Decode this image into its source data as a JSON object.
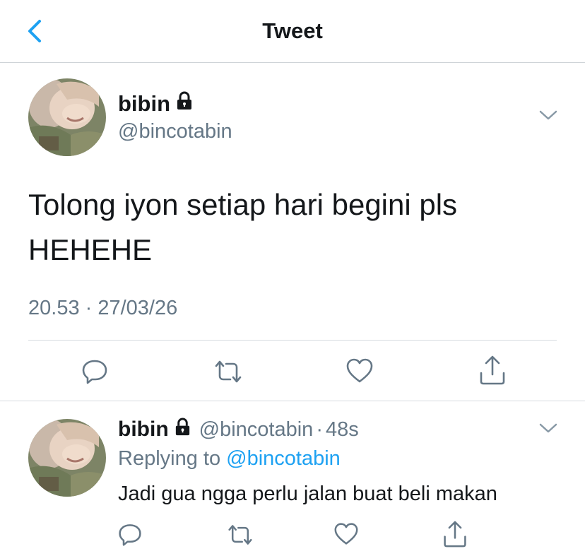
{
  "header": {
    "title": "Tweet",
    "back_icon": "chevron-left-icon",
    "accent_color": "#1da1f2"
  },
  "main_tweet": {
    "author": {
      "display_name": "bibin",
      "handle": "@bincotabin",
      "protected_icon": "lock-icon"
    },
    "text": "Tolong iyon setiap hari begini pls\nHEHEHE",
    "timestamp": "20.53 · 27/03/26",
    "menu_icon": "chevron-down-icon",
    "actions": [
      "reply-icon",
      "retweet-icon",
      "like-icon",
      "share-icon"
    ]
  },
  "reply": {
    "author": {
      "display_name": "bibin",
      "handle": "@bincotabin",
      "protected_icon": "lock-icon"
    },
    "separator": "·",
    "time": "48s",
    "replying_to_prefix": "Replying to ",
    "replying_to_handle": "@bincotabin",
    "text": "Jadi gua ngga perlu jalan buat beli makan",
    "menu_icon": "chevron-down-icon",
    "actions": [
      "reply-icon",
      "retweet-icon",
      "like-icon",
      "share-icon"
    ]
  },
  "colors": {
    "text_primary": "#14171a",
    "text_secondary": "#657786",
    "link": "#1da1f2",
    "divider": "#d6dbdf"
  }
}
